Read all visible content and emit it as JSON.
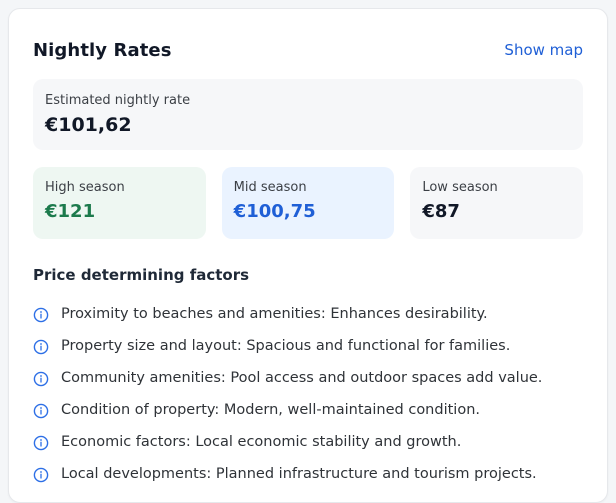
{
  "card": {
    "title": "Nightly Rates",
    "link_label": "Show map"
  },
  "estimate": {
    "label": "Estimated nightly rate",
    "value": "€101,62"
  },
  "seasons": [
    {
      "label": "High season",
      "value": "€121",
      "value_color": "#1c7a4c"
    },
    {
      "label": "Mid season",
      "value": "€100,75",
      "value_color": "#1f5fd6"
    },
    {
      "label": "Low season",
      "value": "€87",
      "value_color": "#111827"
    }
  ],
  "factors": {
    "title": "Price determining factors",
    "icon": "info-icon",
    "icon_color": "#2d6fe6",
    "items": [
      "Proximity to beaches and amenities: Enhances desirability.",
      "Property size and layout: Spacious and functional for families.",
      "Community amenities: Pool access and outdoor spaces add value.",
      "Condition of property: Modern, well-maintained condition.",
      "Economic factors: Local economic stability and growth.",
      "Local developments: Planned infrastructure and tourism projects."
    ]
  }
}
